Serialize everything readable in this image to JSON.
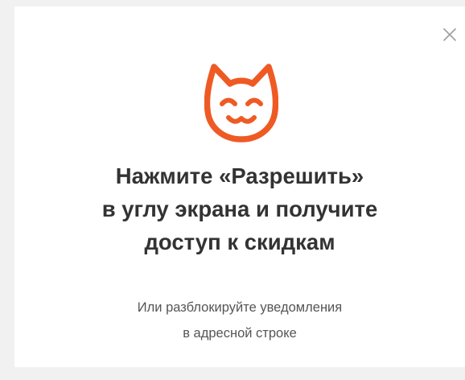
{
  "colors": {
    "accent": "#ef5a24",
    "title_text": "#333333",
    "subtitle_text": "#555555",
    "close_icon": "#9e9e9e"
  },
  "icons": {
    "close": "close-icon",
    "mascot": "cat-icon"
  },
  "dialog": {
    "title_lines": [
      "Нажмите «Разрешить»",
      "в углу экрана и получите",
      "доступ к скидкам"
    ],
    "subtitle_lines": [
      "Или разблокируйте уведомления",
      "в адресной строке"
    ]
  }
}
